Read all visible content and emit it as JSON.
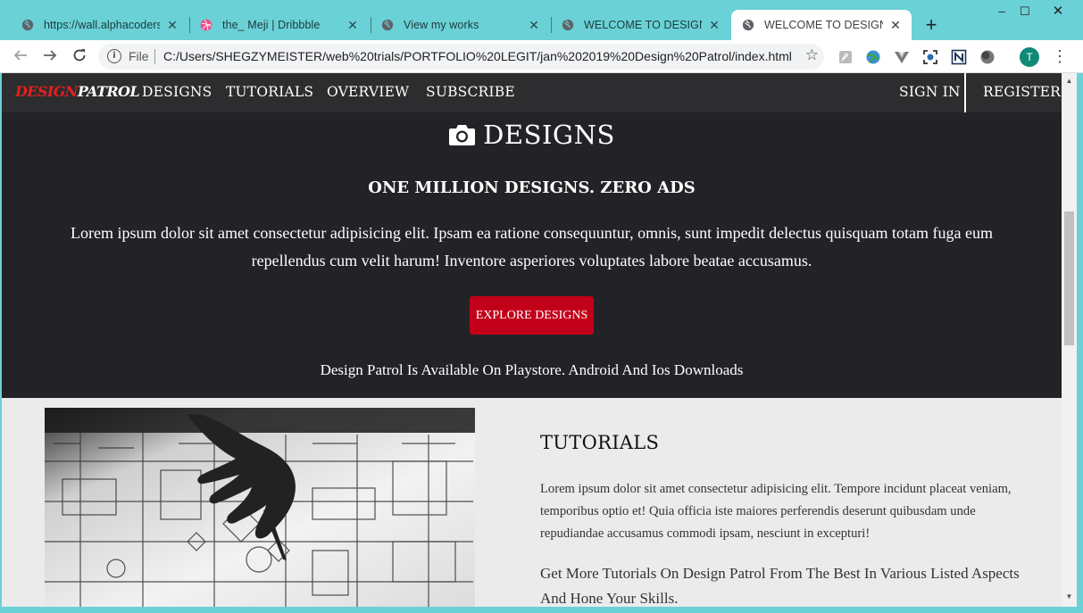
{
  "browser": {
    "tabs": [
      {
        "title": "https://wall.alphacoders.c",
        "icon": "globe-icon"
      },
      {
        "title": "the_ Meji | Dribbble",
        "icon": "dribbble-icon"
      },
      {
        "title": "View my works",
        "icon": "globe-icon"
      },
      {
        "title": "WELCOME TO DESIGN PA",
        "icon": "globe-icon"
      },
      {
        "title": "WELCOME TO DESIGN PA",
        "icon": "globe-icon",
        "active": true
      }
    ],
    "new_tab": "+",
    "tab_close": "✕",
    "window_controls": {
      "minimize": "–",
      "maximize": "☐",
      "close": "✕"
    },
    "omnibox": {
      "scheme_label": "File",
      "url": "C:/Users/SHEGZYMEISTER/web%20trials/PORTFOLIO%20LEGIT/jan%202019%20Design%20Patrol/index.html"
    },
    "profile_initial": "T",
    "colors": {
      "frame": "#6ad1d6",
      "accent": "#c3001a"
    }
  },
  "site": {
    "logo": {
      "part1": "DESIGN",
      "part2": "PATROL"
    },
    "nav": {
      "left": [
        "DESIGNS",
        "TUTORIALS",
        "OVERVIEW",
        "SUBSCRIBE"
      ],
      "sign_in": "SIGN IN",
      "register": "REGISTER"
    },
    "hero": {
      "title": "DESIGNS",
      "subtitle": "ONE MILLION DESIGNS. ZERO ADS",
      "text": "Lorem ipsum dolor sit amet consectetur adipisicing elit. Ipsam ea ratione consequuntur, omnis, sunt impedit delectus quisquam totam fuga eum repellendus cum velit harum! Inventore asperiores voluptates labore beatae accusamus.",
      "button": "EXPLORE DESIGNS",
      "footer": "Design Patrol Is Available On Playstore. Android And Ios Downloads"
    },
    "tutorials": {
      "title": "TUTORIALS",
      "text": "Lorem ipsum dolor sit amet consectetur adipisicing elit. Tempore incidunt placeat veniam, temporibus optio et! Quia officia iste maiores perferendis deserunt quibusdam unde repudiandae accusamus commodi ipsam, nesciunt in excepturi!",
      "more": "Get More Tutorials On Design Patrol From The Best In Various Listed Aspects And Hone Your Skills."
    }
  }
}
